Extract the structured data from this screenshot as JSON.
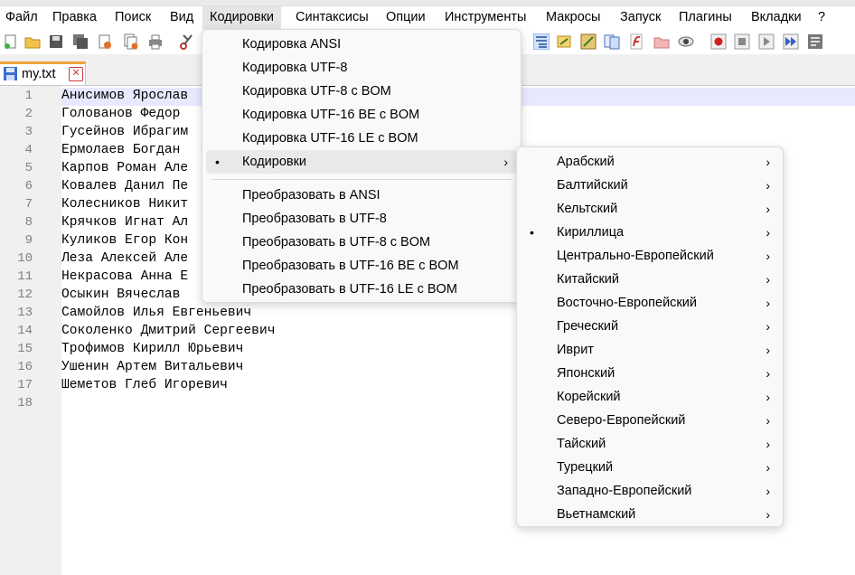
{
  "menubar": {
    "items": [
      "Файл",
      "Правка",
      "Поиск",
      "Вид",
      "Кодировки",
      "Синтаксисы",
      "Опции",
      "Инструменты",
      "Макросы",
      "Запуск",
      "Плагины",
      "Вкладки",
      "?"
    ]
  },
  "tab": {
    "name": "my.txt",
    "close": "✕"
  },
  "editor": {
    "line_numbers": [
      "1",
      "2",
      "3",
      "4",
      "5",
      "6",
      "7",
      "8",
      "9",
      "10",
      "11",
      "12",
      "13",
      "14",
      "15",
      "16",
      "17",
      "18"
    ],
    "lines": [
      "Анисимов Ярослав",
      "Голованов Федор",
      "Гусейнов Ибрагим",
      "Ермолаев Богдан",
      "Карпов Роман Але",
      "Ковалев Данил Пе",
      "Колесников Никит",
      "Крячков Игнат Ал",
      "Куликов Егор Кон",
      "Леза Алексей Але",
      "Некрасова Анна Е",
      "Осыкин Вячеслав",
      "Самойлов Илья Евгеньевич",
      "Соколенко Дмитрий Сергеевич",
      "Трофимов Кирилл Юрьевич",
      "Ушенин Артем Витальевич",
      "Шеметов Глеб Игоревич",
      ""
    ]
  },
  "encoding_menu": {
    "items": [
      "Кодировка ANSI",
      "Кодировка UTF-8",
      "Кодировка UTF-8 с BOM",
      "Кодировка UTF-16 BE с BOM",
      "Кодировка UTF-16 LE с BOM",
      "Кодировки"
    ],
    "convert_items": [
      "Преобразовать в ANSI",
      "Преобразовать в UTF-8",
      "Преобразовать в UTF-8 с BOM",
      "Преобразовать в UTF-16 BE с BOM",
      "Преобразовать в UTF-16 LE с BOM"
    ],
    "bullet": "•",
    "arrow": "›"
  },
  "charset_menu": {
    "items": [
      "Арабский",
      "Балтийский",
      "Кельтский",
      "Кириллица",
      "Центрально-Европейский",
      "Китайский",
      "Восточно-Европейский",
      "Греческий",
      "Иврит",
      "Японский",
      "Корейский",
      "Северо-Европейский",
      "Тайский",
      "Турецкий",
      "Западно-Европейский",
      "Вьетнамский"
    ],
    "selected_index": 3
  }
}
